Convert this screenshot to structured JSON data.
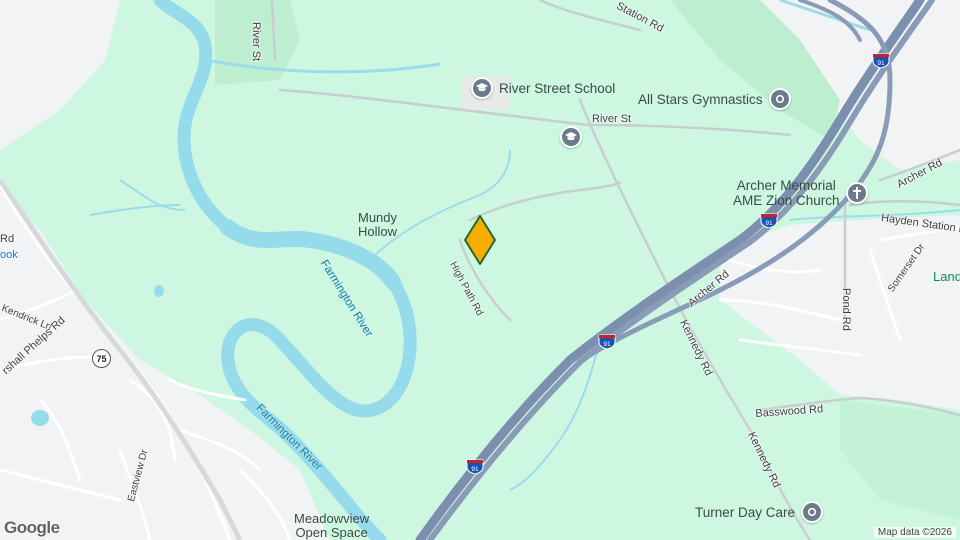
{
  "roads": {
    "river_st_north": "River St",
    "river_st": "River St",
    "station_rd": "Station Rd",
    "high_path_rd": "High Path Rd",
    "archer_rd_east": "Archer Rd",
    "archer_rd": "Archer Rd",
    "hayden_station": "Hayden Station R",
    "somerset_dr": "Somerset Dr",
    "pond_rd": "Pond Rd",
    "kennedy_rd_1": "Kennedy Rd",
    "kennedy_rd_2": "Kennedy Rd",
    "basswood_rd": "Basswood Rd",
    "kendrick_ln": "Kendrick Ln",
    "marshall_phelps_rd": "rshall Phelps Rd",
    "eastview_dr": "Eastview Dr",
    "left_rd_fragment": "Rd",
    "left_rd_fragment2": "ook"
  },
  "water": {
    "farmington_river_1": "Farmington River",
    "farmington_river_2": "Farmington River"
  },
  "places": {
    "mundy_hollow": [
      "Mundy",
      "Hollow"
    ],
    "meadowview": [
      "Meadowview",
      "Open Space"
    ],
    "land_fragment": "Land"
  },
  "pois": {
    "river_street_school": "River Street School",
    "all_stars_gymnastics": "All Stars Gymnastics",
    "archer_memorial": [
      "Archer Memorial",
      "AME Zion Church"
    ],
    "turner_day_care": "Turner Day Care"
  },
  "shields": {
    "interstate": "91",
    "state_route": "75"
  },
  "footer": {
    "attribution": "Map data ©2026",
    "logo": "Google"
  },
  "colors": {
    "park": "#cdf7e1",
    "water": "#96dbeb",
    "highway": "#8a9bb8",
    "urban": "#f1f3f4",
    "pin": "#f9ab00"
  }
}
